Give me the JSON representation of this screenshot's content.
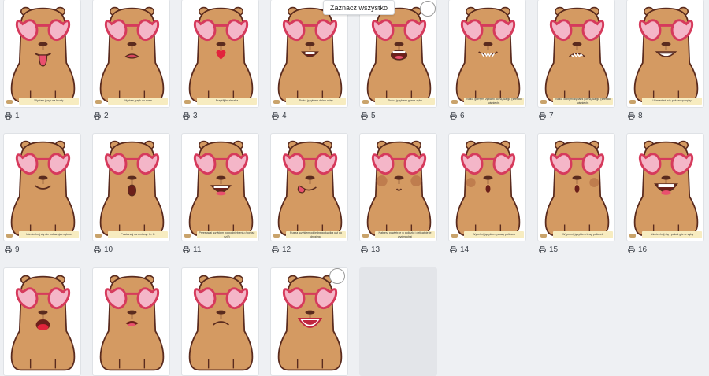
{
  "tooltip": {
    "label": "Zaznacz wszystko"
  },
  "pages": [
    {
      "num": "1",
      "caption": "Wystaw język na brodę",
      "mouth": "tongue"
    },
    {
      "num": "2",
      "caption": "Wystaw język do nosa",
      "mouth": "tongue-up"
    },
    {
      "num": "3",
      "caption": "Przyślij buziaczka",
      "mouth": "kiss"
    },
    {
      "num": "4",
      "caption": "Policz językiem dolne zęby",
      "mouth": "teeth-down"
    },
    {
      "num": "5",
      "caption": "Policz językiem górne zęby",
      "mouth": "teeth-up"
    },
    {
      "num": "6",
      "caption": "Nałóż górnymi zębami dolną wargę (szeroki uśmiech)",
      "mouth": "bite-low"
    },
    {
      "num": "7",
      "caption": "Nałóż dolnymi zębami górną wargę (szeroki uśmiech)",
      "mouth": "bite-up"
    },
    {
      "num": "8",
      "caption": "Uśmiechnij się pokazując zęby",
      "mouth": "smile-teeth"
    },
    {
      "num": "9",
      "caption": "Uśmiechnij się nie pokazując zębów",
      "mouth": "smile"
    },
    {
      "num": "10",
      "caption": "Powtarzaj na zmianę: I – O",
      "mouth": "o"
    },
    {
      "num": "11",
      "caption": "Przesuwaj językiem po podniebieniu (porusz szlif)",
      "mouth": "open-teeth"
    },
    {
      "num": "12",
      "caption": "Rusza językiem od jednego kącika ust do drugiego",
      "mouth": "tongue-side"
    },
    {
      "num": "13",
      "caption": "Nabierz powietrze w policzki i delikatnie je wydmuchaj",
      "mouth": "puff"
    },
    {
      "num": "14",
      "caption": "Wypchnij językiem prawy policzek",
      "mouth": "push-left"
    },
    {
      "num": "15",
      "caption": "Wypchnij językiem lewy policzek",
      "mouth": "push-right"
    },
    {
      "num": "16",
      "caption": "Uśmiechnij się i pokaż górne zęby",
      "mouth": "grin"
    },
    {
      "num": "",
      "caption": "",
      "mouth": "tongue-red"
    },
    {
      "num": "",
      "caption": "",
      "mouth": "small-open"
    },
    {
      "num": "",
      "caption": "",
      "mouth": "frown"
    },
    {
      "num": "",
      "caption": "",
      "mouth": "wide-open"
    },
    {
      "num": "",
      "caption": "",
      "mouth": "blank"
    }
  ],
  "colors": {
    "fur": "#d49a62",
    "furDark": "#5a2b1e",
    "glasses": "#d63a5c",
    "lens": "#f4b6c8",
    "bg": "#eef0f3"
  }
}
